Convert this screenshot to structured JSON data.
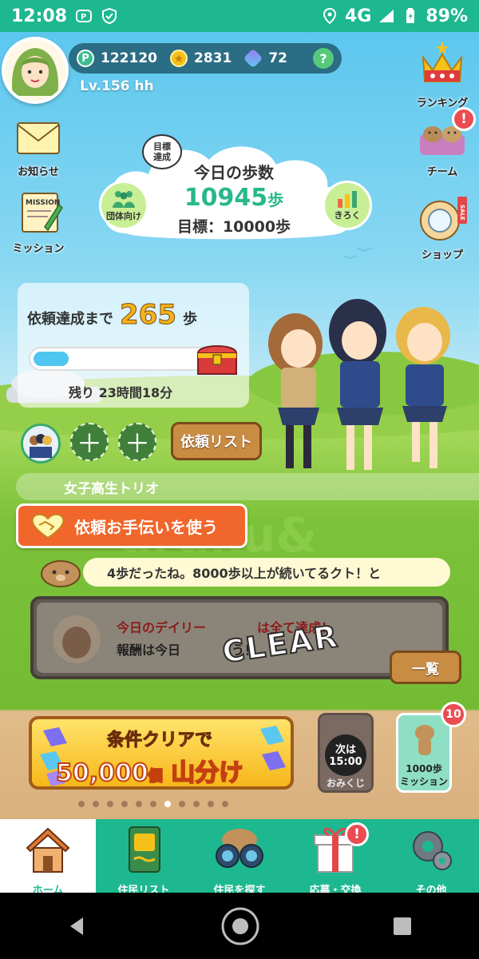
{
  "status_bar": {
    "time": "12:08",
    "network": "4G",
    "battery": "89%"
  },
  "player": {
    "points": "122120",
    "coins": "2831",
    "gems": "72",
    "level": "Lv.156 hh",
    "help_label": "?"
  },
  "side_left": [
    {
      "label": "お知らせ"
    },
    {
      "label": "ミッション"
    }
  ],
  "side_right": [
    {
      "label": "ランキング"
    },
    {
      "label": "チーム"
    },
    {
      "label": "ショップ"
    }
  ],
  "badges": {
    "team": "!",
    "gift": "!",
    "mission_count": "10"
  },
  "steps": {
    "bubble": "目標\n達成",
    "title": "今日の歩数",
    "count": "10945",
    "unit": "歩",
    "goal": "目標：10000歩",
    "group_label": "団体向け",
    "record_label": "きろく",
    "mission_icon_text": "MISSION",
    "sale_tag": "SALE"
  },
  "request": {
    "prefix": "依頼達成まで",
    "count": "265",
    "unit": "歩",
    "progress": 0.2,
    "remaining": "残り 23時間18分",
    "list_button": "依頼リスト",
    "slot_plus": "＋"
  },
  "group": {
    "name": "女子高生トリオ",
    "help_button": "依頼お手伝いを使う"
  },
  "message": "4歩だったね。8000歩以上が続いてるクト！と",
  "daily": {
    "line1": "今日のデイリー　　　　は全て達成！",
    "line2": "報酬は今日　　　　う！",
    "stamp": "CLEAR",
    "list_button": "一覧"
  },
  "banner": {
    "line1": "条件クリアで",
    "amount": "50,000",
    "amount_unit": "個",
    "line2_suffix": "山分け"
  },
  "omikuji": {
    "next": "次は",
    "time": "15:00",
    "label": "おみくじ"
  },
  "mission_1000": {
    "line1": "1000歩",
    "line2": "ミッション"
  },
  "carousel": {
    "count": 11,
    "active": 6
  },
  "nav": [
    {
      "label": "ホーム",
      "icon": "house-icon"
    },
    {
      "label": "住民リスト",
      "icon": "book-icon"
    },
    {
      "label": "住民を探す",
      "icon": "binoculars-icon"
    },
    {
      "label": "応募・交換",
      "icon": "gift-icon"
    },
    {
      "label": "その他",
      "icon": "gear-icon"
    }
  ],
  "colors": {
    "primary": "#1db88f",
    "steps_green": "#28b88c",
    "orange": "#f0662b",
    "gold": "#f6b21a"
  }
}
